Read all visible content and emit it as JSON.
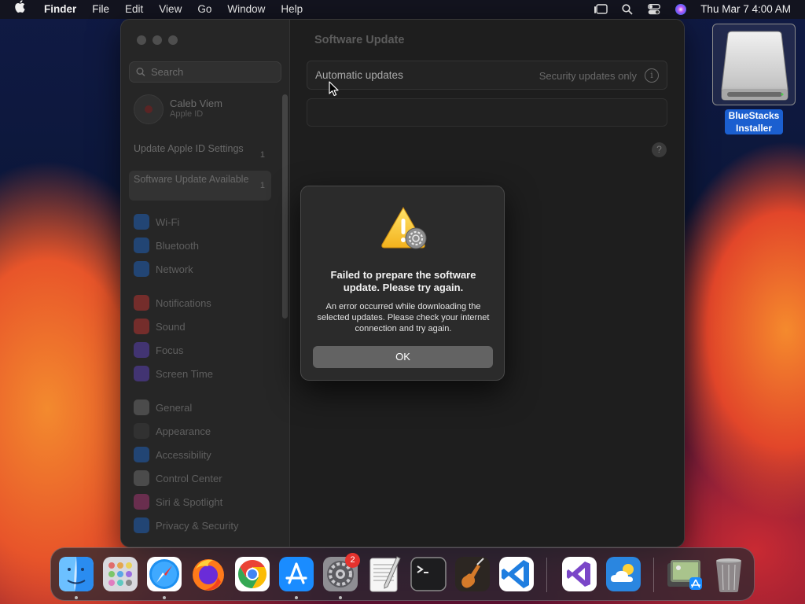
{
  "menubar": {
    "app_name": "Finder",
    "menus": [
      "File",
      "Edit",
      "View",
      "Go",
      "Window",
      "Help"
    ],
    "status_icons": [
      "stage-manager-icon",
      "spotlight-search-icon",
      "control-center-icon",
      "siri-icon"
    ],
    "clock": "Thu Mar 7  4:00 AM"
  },
  "settings_window": {
    "sidebar": {
      "search_placeholder": "Search",
      "account": {
        "name": "Caleb Viem",
        "subtitle": "Apple ID"
      },
      "notices": [
        {
          "label": "Update Apple ID Settings",
          "count": "1"
        },
        {
          "label": "Software Update Available",
          "count": "1"
        }
      ],
      "items": [
        {
          "label": "Wi-Fi",
          "icon": "wifi-icon",
          "color": "#1f5fb5"
        },
        {
          "label": "Bluetooth",
          "icon": "bluetooth-icon",
          "color": "#1f5fb5"
        },
        {
          "label": "Network",
          "icon": "globe-icon",
          "color": "#1f5fb5"
        },
        {
          "label": "Notifications",
          "icon": "bell-icon",
          "color": "#b5332f"
        },
        {
          "label": "Sound",
          "icon": "speaker-icon",
          "color": "#b5332f"
        },
        {
          "label": "Focus",
          "icon": "moon-icon",
          "color": "#5a3fb0"
        },
        {
          "label": "Screen Time",
          "icon": "hourglass-icon",
          "color": "#5a3fb0"
        },
        {
          "label": "General",
          "icon": "gear-icon",
          "color": "#6a6a6a"
        },
        {
          "label": "Appearance",
          "icon": "appearance-icon",
          "color": "#3a3a3a"
        },
        {
          "label": "Accessibility",
          "icon": "accessibility-icon",
          "color": "#1f5fb5"
        },
        {
          "label": "Control Center",
          "icon": "control-center-icon",
          "color": "#6a6a6a"
        },
        {
          "label": "Siri & Spotlight",
          "icon": "siri-icon",
          "color": "#a03570"
        },
        {
          "label": "Privacy & Security",
          "icon": "hand-icon",
          "color": "#1f5fb5"
        }
      ]
    },
    "pane": {
      "title": "Software Update",
      "automatic_updates_label": "Automatic updates",
      "automatic_updates_value": "Security updates only",
      "info_glyph": "i",
      "help_glyph": "?"
    }
  },
  "alert": {
    "icon": "warning-gear-icon",
    "title": "Failed to prepare the software update. Please try again.",
    "message": "An error occurred while downloading the selected updates. Please check your internet connection and try again.",
    "button_label": "OK"
  },
  "desktop": {
    "drive_label": "BlueStacks Installer",
    "drive_icon": "external-drive-icon"
  },
  "dock": {
    "apps": [
      "Finder",
      "Launchpad",
      "Safari",
      "Firefox",
      "Google Chrome",
      "App Store",
      "System Settings",
      "TextEdit",
      "Terminal",
      "GarageBand",
      "Visual Studio Code",
      "Visual Studio",
      "Weather",
      "Preview",
      "Trash"
    ],
    "badge": "2"
  }
}
